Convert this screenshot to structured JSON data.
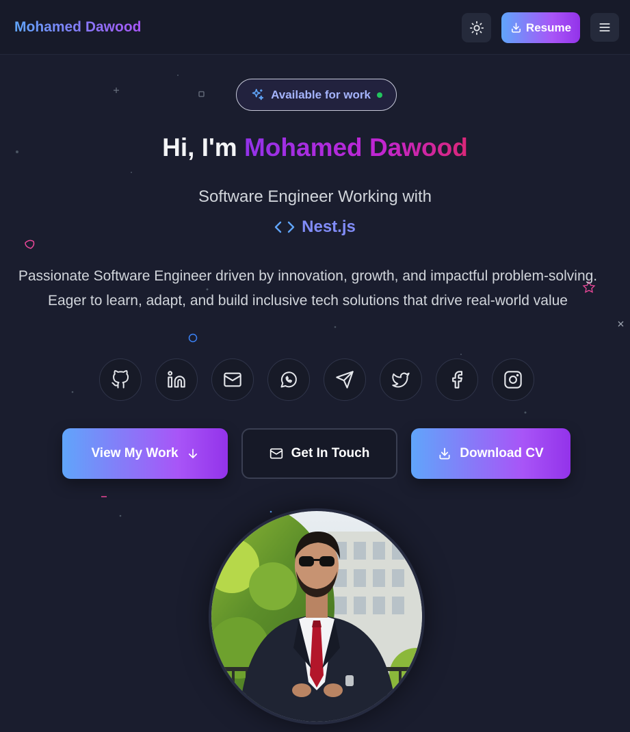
{
  "navbar": {
    "brand": "Mohamed Dawood",
    "theme_toggle_icon": "sun-icon",
    "resume_label": "Resume",
    "resume_icon": "download-icon",
    "menu_icon": "hamburger-menu-icon"
  },
  "hero": {
    "status_badge": "Available for work",
    "greeting_prefix": "Hi, I'm",
    "name": "Mohamed Dawood",
    "subtitle": "Software Engineer Working with",
    "technology": "Nest.js",
    "description": "Passionate Software Engineer driven by innovation, growth, and impactful problem-solving. Eager to learn, adapt, and build inclusive tech solutions that drive real-world value"
  },
  "social_links": [
    {
      "name": "github",
      "icon": "github-icon"
    },
    {
      "name": "linkedin",
      "icon": "linkedin-icon"
    },
    {
      "name": "email",
      "icon": "mail-icon"
    },
    {
      "name": "whatsapp",
      "icon": "whatsapp-icon"
    },
    {
      "name": "telegram",
      "icon": "send-icon"
    },
    {
      "name": "twitter",
      "icon": "twitter-icon"
    },
    {
      "name": "facebook",
      "icon": "facebook-icon"
    },
    {
      "name": "instagram",
      "icon": "instagram-icon"
    }
  ],
  "actions": {
    "view_work": "View My Work",
    "get_in_touch": "Get In Touch",
    "download_cv": "Download CV"
  },
  "colors": {
    "background": "#1a1d2e",
    "accent_blue": "#60a5fa",
    "accent_purple": "#a855f7",
    "accent_pink": "#db2777",
    "status_green": "#22c55e"
  }
}
